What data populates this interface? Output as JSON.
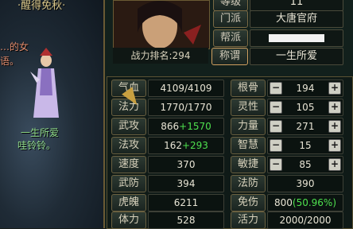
{
  "scene": {
    "title_line": "·醒得免秋·",
    "chat_line1": "…的女",
    "chat_line2": "语。",
    "character_name": "一生所爱",
    "character_title": "哇铃铃。"
  },
  "header": {
    "level_label": "等级",
    "level_value": "11",
    "faction_label": "门派",
    "faction_value": "大唐官府",
    "guild_label": "帮派",
    "guild_value": "",
    "title_label": "称谓",
    "title_value": "一生所爱",
    "rank_text": "战力排名:294"
  },
  "stats_left": [
    {
      "label": "气血",
      "value": "4109/4109",
      "bonus": ""
    },
    {
      "label": "法力",
      "value": "1770/1770",
      "bonus": ""
    },
    {
      "label": "武攻",
      "value": "866",
      "bonus": "+1570"
    },
    {
      "label": "法攻",
      "value": "162",
      "bonus": "+293"
    },
    {
      "label": "速度",
      "value": "370",
      "bonus": ""
    },
    {
      "label": "武防",
      "value": "394",
      "bonus": ""
    },
    {
      "label": "虎魄",
      "value": "6211",
      "bonus": ""
    },
    {
      "label": "体力",
      "value": "528",
      "bonus": ""
    }
  ],
  "stats_right": [
    {
      "label": "根骨",
      "value": "194",
      "stepper": true
    },
    {
      "label": "灵性",
      "value": "105",
      "stepper": true
    },
    {
      "label": "力量",
      "value": "271",
      "stepper": true
    },
    {
      "label": "智慧",
      "value": "15",
      "stepper": true
    },
    {
      "label": "敏捷",
      "value": "85",
      "stepper": true
    },
    {
      "label": "法防",
      "value": "390",
      "stepper": false
    },
    {
      "label": "免伤",
      "value": "800",
      "bonus": "(50.96%)",
      "stepper": false
    },
    {
      "label": "活力",
      "value": "2000/2000",
      "stepper": false
    }
  ],
  "buttons": {
    "minus": "−",
    "plus": "+"
  }
}
